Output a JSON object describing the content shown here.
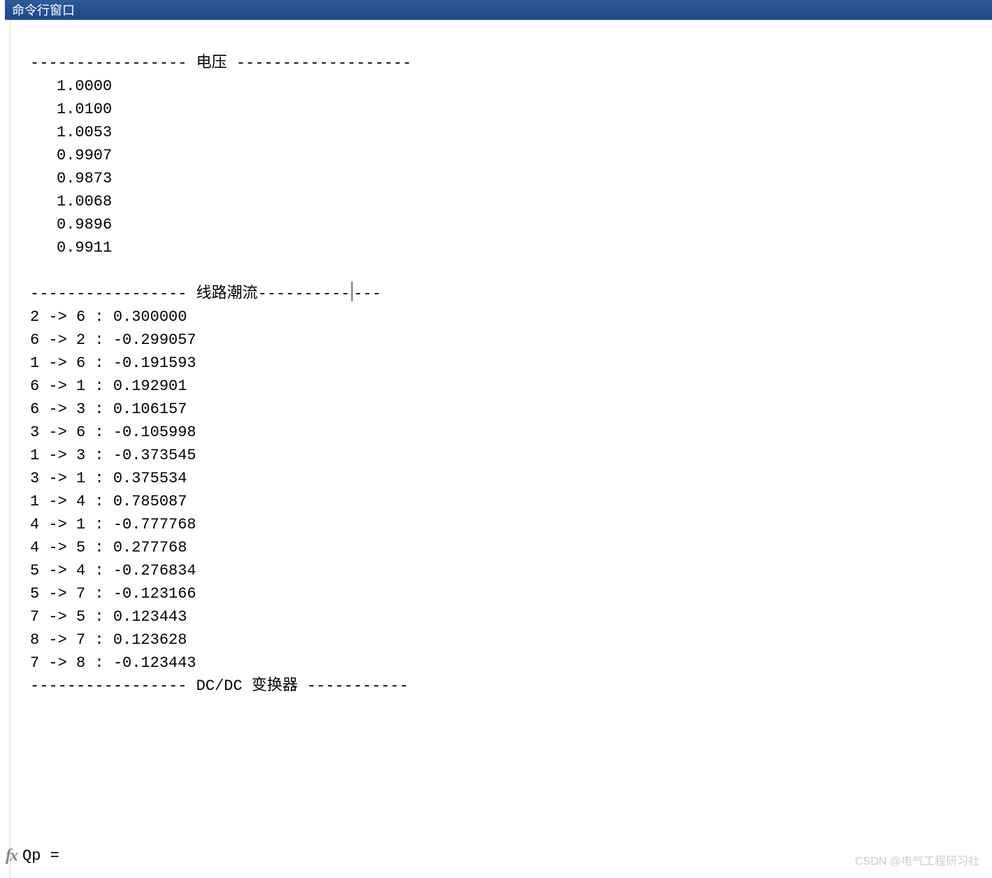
{
  "window": {
    "title": "命令行窗口"
  },
  "sections": {
    "voltage_header": "----------------- 电压 -------------------",
    "voltage_values": [
      "1.0000",
      "1.0100",
      "1.0053",
      "0.9907",
      "0.9873",
      "1.0068",
      "0.9896",
      "0.9911"
    ],
    "lineflow_header_pre": "----------------- 线路潮流----------",
    "lineflow_header_post": "---",
    "lineflow": [
      "2 -> 6 : 0.300000",
      "6 -> 2 : -0.299057",
      "1 -> 6 : -0.191593",
      "6 -> 1 : 0.192901",
      "6 -> 3 : 0.106157",
      "3 -> 6 : -0.105998",
      "1 -> 3 : -0.373545",
      "3 -> 1 : 0.375534",
      "1 -> 4 : 0.785087",
      "4 -> 1 : -0.777768",
      "4 -> 5 : 0.277768",
      "5 -> 4 : -0.276834",
      "5 -> 7 : -0.123166",
      "7 -> 5 : 0.123443",
      "8 -> 7 : 0.123628",
      "7 -> 8 : -0.123443"
    ],
    "dcdc_header": "----------------- DC/DC 变换器 -----------",
    "prompt_var": "Qp ="
  },
  "watermark": "CSDN @电气工程研习社"
}
